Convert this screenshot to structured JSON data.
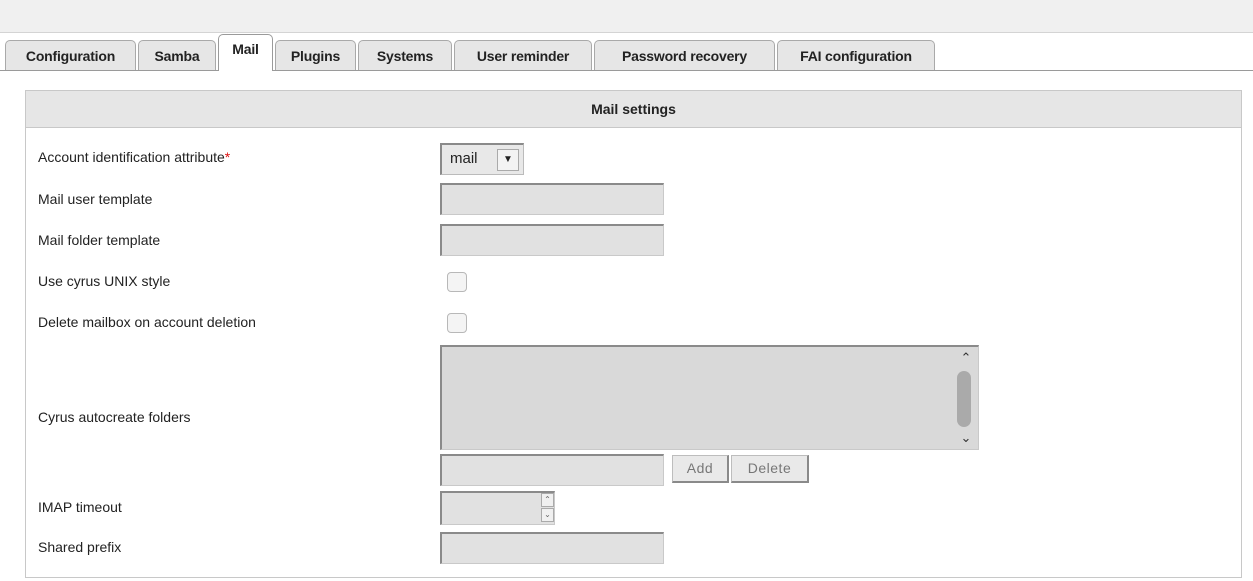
{
  "tabs": [
    {
      "label": "Configuration",
      "active": false
    },
    {
      "label": "Samba",
      "active": false
    },
    {
      "label": "Mail",
      "active": true
    },
    {
      "label": "Plugins",
      "active": false
    },
    {
      "label": "Systems",
      "active": false
    },
    {
      "label": "User reminder",
      "active": false
    },
    {
      "label": "Password recovery",
      "active": false
    },
    {
      "label": "FAI configuration",
      "active": false
    }
  ],
  "panel": {
    "title": "Mail settings",
    "fields": {
      "account_id_label": "Account identification attribute",
      "required_marker": "*",
      "account_id_value": "mail",
      "mail_user_template_label": "Mail user template",
      "mail_user_template_value": "",
      "mail_folder_template_label": "Mail folder template",
      "mail_folder_template_value": "",
      "cyrus_unix_style_label": "Use cyrus UNIX style",
      "cyrus_unix_style_checked": false,
      "delete_mailbox_label": "Delete mailbox on account deletion",
      "delete_mailbox_checked": false,
      "cyrus_autocreate_label": "Cyrus autocreate folders",
      "cyrus_autocreate_items": [],
      "add_label": "Add",
      "delete_label": "Delete",
      "imap_timeout_label": "IMAP timeout",
      "imap_timeout_value": "",
      "shared_prefix_label": "Shared prefix",
      "shared_prefix_value": ""
    }
  },
  "icons": {
    "dropdown": "triangle-down-icon",
    "scroll_up": "chevron-up-icon",
    "scroll_down": "chevron-down-icon"
  }
}
